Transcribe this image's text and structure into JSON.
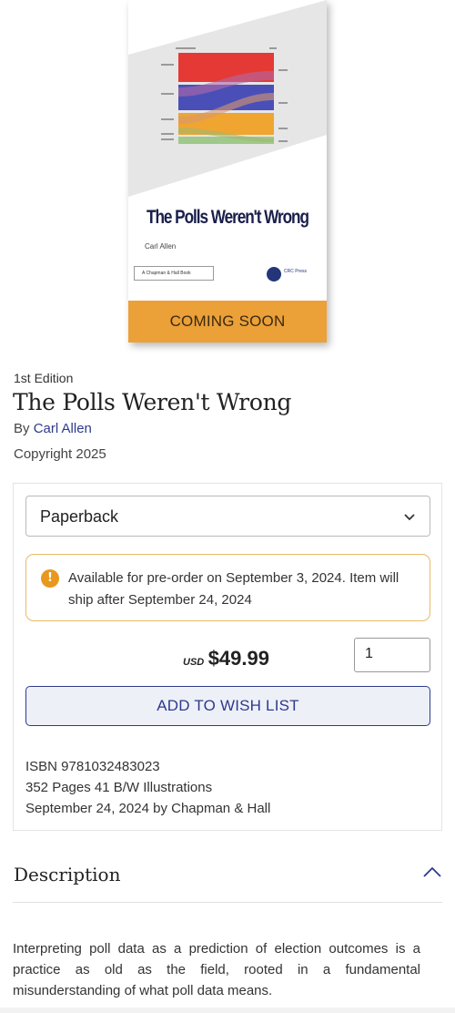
{
  "cover": {
    "title": "The Polls Weren't Wrong",
    "author": "Carl Allen",
    "publisher": "A Chapman & Hall Book",
    "crc": "CRC Press",
    "banner": "COMING SOON"
  },
  "book": {
    "edition": "1st Edition",
    "title": "The Polls Weren't Wrong",
    "by_prefix": "By ",
    "author": "Carl Allen",
    "copyright": "Copyright 2025"
  },
  "purchase": {
    "format_selected": "Paperback",
    "notice": "Available for pre-order on September 3, 2024. Item will ship after September 24, 2024",
    "notice_icon": "!",
    "currency": "USD",
    "price": "$49.99",
    "quantity": "1",
    "wish_label": "ADD TO WISH LIST",
    "isbn": "ISBN 9781032483023",
    "pages": "352 Pages 41 B/W Illustrations",
    "pub_date": "September 24, 2024 by Chapman & Hall"
  },
  "description": {
    "heading": "Description",
    "body": "Interpreting poll data as a prediction of election outcomes is a practice as old as the field, rooted in a fundamental misunderstanding of what poll data means."
  },
  "colors": {
    "accent": "#2d3a8c",
    "banner": "#eba038",
    "warning": "#e8981f"
  }
}
